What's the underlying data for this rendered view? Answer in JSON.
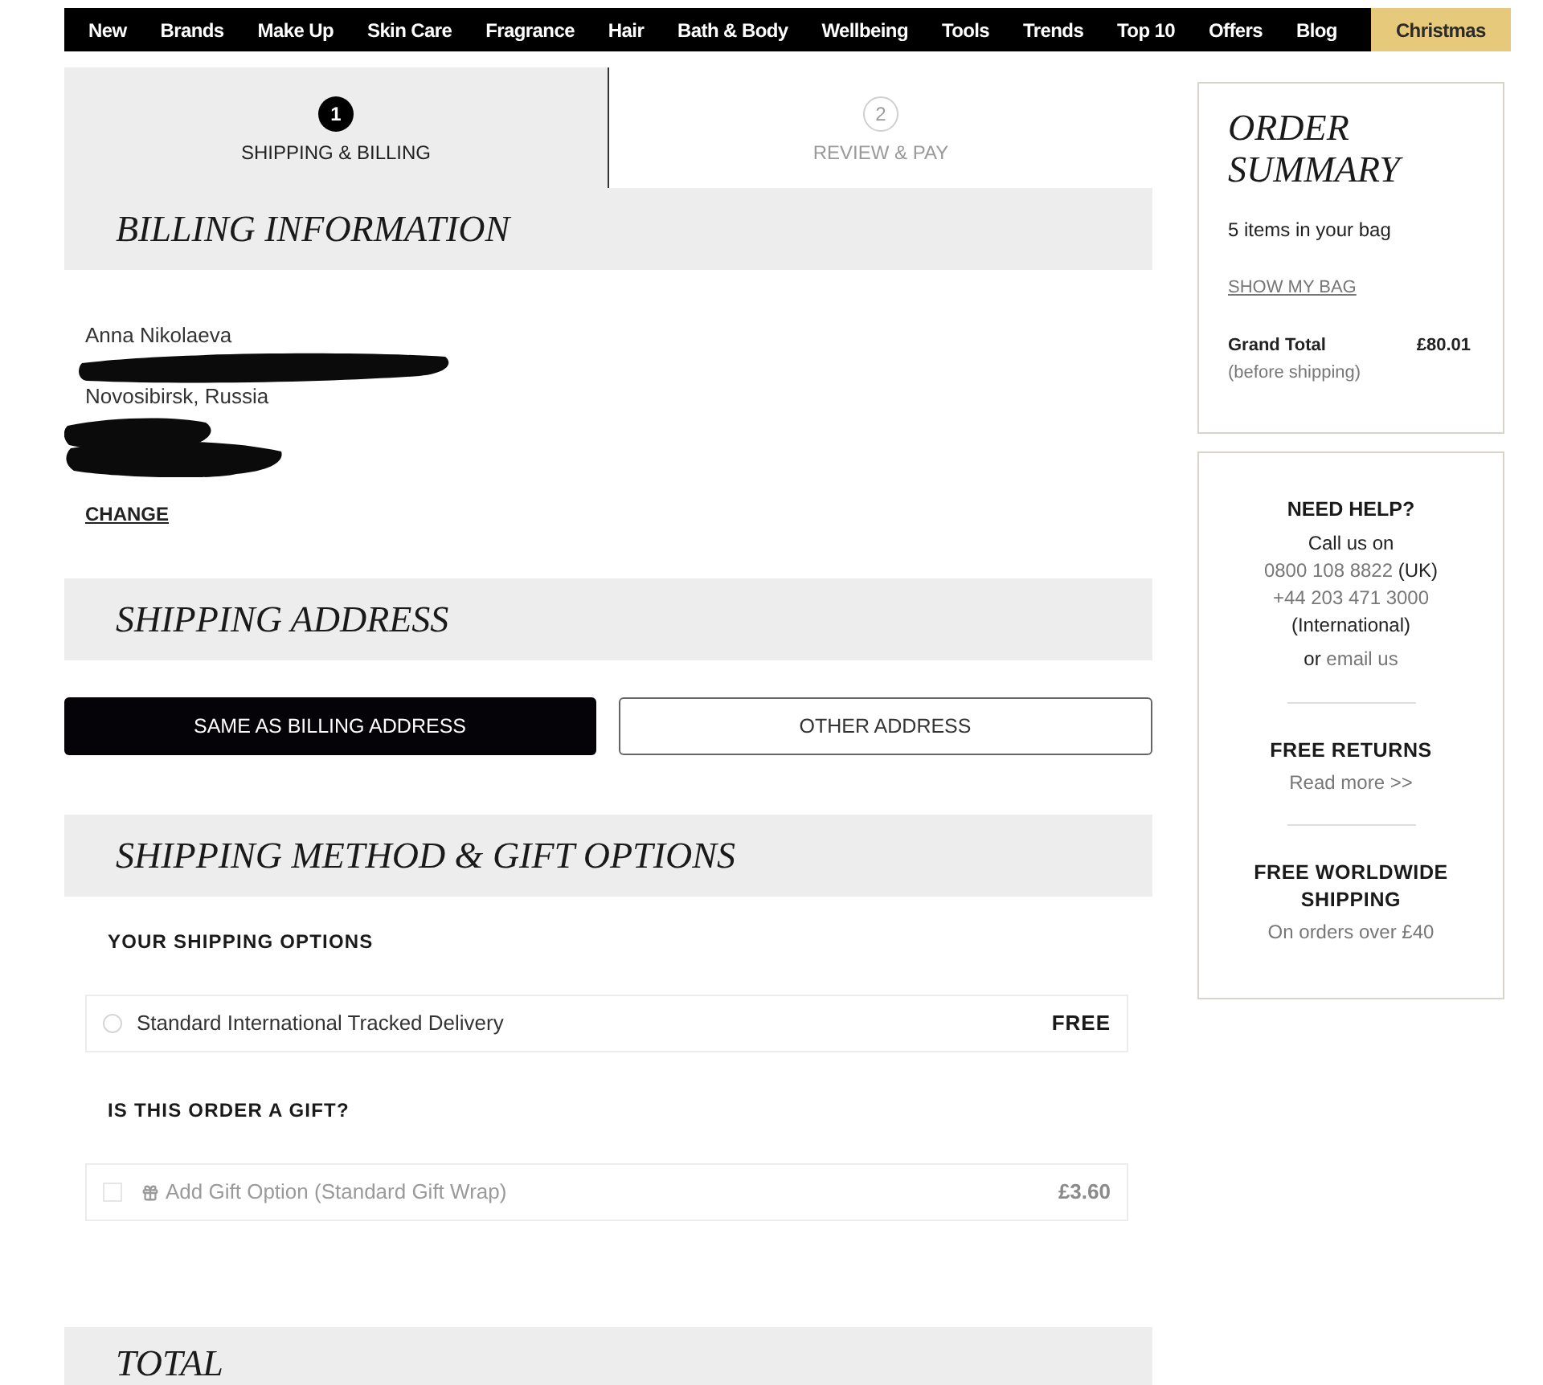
{
  "nav": {
    "items": [
      {
        "label": "New",
        "highlighted": false
      },
      {
        "label": "Brands",
        "highlighted": false
      },
      {
        "label": "Make Up",
        "highlighted": false
      },
      {
        "label": "Skin Care",
        "highlighted": false
      },
      {
        "label": "Fragrance",
        "highlighted": false
      },
      {
        "label": "Hair",
        "highlighted": false
      },
      {
        "label": "Bath & Body",
        "highlighted": false
      },
      {
        "label": "Wellbeing",
        "highlighted": false
      },
      {
        "label": "Tools",
        "highlighted": false
      },
      {
        "label": "Trends",
        "highlighted": false
      },
      {
        "label": "Top 10",
        "highlighted": false
      },
      {
        "label": "Offers",
        "highlighted": false
      },
      {
        "label": "Blog",
        "highlighted": false
      },
      {
        "label": "Christmas",
        "highlighted": true
      }
    ]
  },
  "steps": [
    {
      "number": "1",
      "label": "SHIPPING & BILLING",
      "selected": true
    },
    {
      "number": "2",
      "label": "REVIEW & PAY",
      "selected": false
    }
  ],
  "billing": {
    "title": "BILLING INFORMATION",
    "name": "Anna Nikolaeva",
    "city": "Novosibirsk, Russia",
    "change_link": "CHANGE"
  },
  "shipping_address": {
    "title": "SHIPPING ADDRESS",
    "options": [
      {
        "label": "SAME AS BILLING ADDRESS",
        "selected": true
      },
      {
        "label": "OTHER ADDRESS",
        "selected": false
      }
    ]
  },
  "shipping_method": {
    "title": "SHIPPING METHOD & GIFT OPTIONS",
    "options_heading": "YOUR SHIPPING OPTIONS",
    "options": [
      {
        "label": "Standard International Tracked Delivery",
        "price": "FREE",
        "selected": false
      }
    ],
    "gift_heading": "IS THIS ORDER A GIFT?",
    "gift": {
      "label": "Add Gift Option (Standard Gift Wrap)",
      "price": "£3.60",
      "checked": false,
      "disabled": true
    }
  },
  "total": {
    "title": "TOTAL"
  },
  "order_summary": {
    "title": "ORDER SUMMARY",
    "items_text": "5 items in your bag",
    "show_bag_link": "SHOW MY BAG",
    "grand_total_label": "Grand Total",
    "grand_total_value": "£80.01",
    "grand_total_note": "(before shipping)"
  },
  "help": {
    "title": "NEED HELP?",
    "call_label": "Call us on",
    "phones": [
      {
        "number": "0800 108 8822",
        "note": "(UK)"
      },
      {
        "number": "+44 203 471 3000",
        "note": "(International)"
      }
    ],
    "email_prefix": "or",
    "email_link": "email us"
  },
  "perks": [
    {
      "title": "FREE RETURNS",
      "link": "Read more >>"
    },
    {
      "title": "FREE WORLDWIDE SHIPPING",
      "text": "On orders over £40"
    }
  ]
}
